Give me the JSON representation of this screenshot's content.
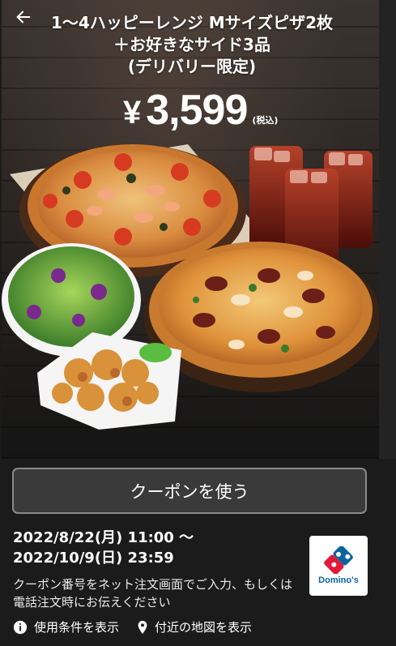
{
  "header": {
    "line1": "1～4ハッピーレンジ Mサイズピザ2枚",
    "line2": "＋お好きなサイド3品",
    "line3": "(デリバリー限定)"
  },
  "price": {
    "currency": "¥",
    "amount": "3,599",
    "tax_note": "(税込)"
  },
  "coupon": {
    "use_button": "クーポンを使う",
    "date_line1": "2022/8/22(月) 11:00 ～",
    "date_line2": "2022/10/9(日) 23:59",
    "note": "クーポン番号をネット注文画面でご入力、もしくは電話注文時にお伝えください"
  },
  "brand": {
    "logo_text": "Domino's",
    "blue": "#0b64a0",
    "red": "#e31837"
  },
  "links": {
    "terms": "使用条件を表示",
    "map": "付近の地図を表示"
  },
  "icons": [
    "back-arrow-icon",
    "info-icon",
    "location-pin-icon"
  ]
}
